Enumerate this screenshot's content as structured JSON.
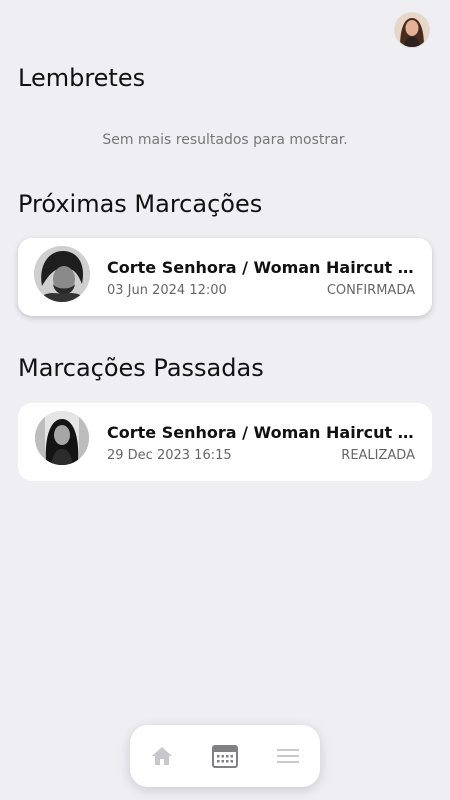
{
  "sections": {
    "reminders_title": "Lembretes",
    "reminders_empty": "Sem mais resultados para mostrar.",
    "upcoming_title": "Próximas Marcações",
    "past_title": "Marcações Passadas"
  },
  "upcoming": [
    {
      "service": "Corte Senhora / Woman Haircut @F...",
      "date": "03 Jun 2024 12:00",
      "status": "CONFIRMADA"
    }
  ],
  "past": [
    {
      "service": "Corte Senhora / Woman Haircut @F...",
      "date": "29 Dec 2023 16:15",
      "status": "REALIZADA"
    }
  ],
  "nav": {
    "items": [
      {
        "icon": "home-icon",
        "active": false
      },
      {
        "icon": "calendar-icon",
        "active": true
      },
      {
        "icon": "menu-icon",
        "active": false
      }
    ]
  },
  "colors": {
    "background": "#efeef3",
    "card": "#ffffff",
    "icon_inactive": "#c8c8cc",
    "icon_active": "#7f7f84"
  }
}
